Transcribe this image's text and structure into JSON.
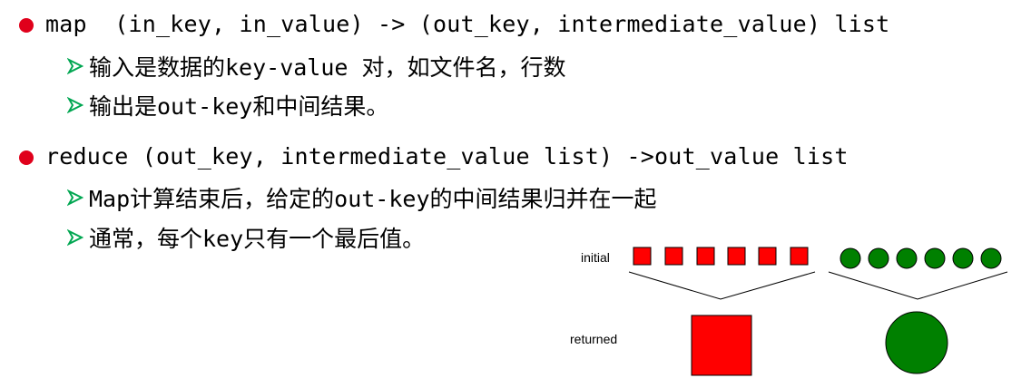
{
  "bullets": [
    {
      "text": "map  (in_key, in_value) -> (out_key, intermediate_value) list",
      "subitems": [
        "输入是数据的key-value 对，如文件名，行数",
        "输出是out-key和中间结果。"
      ]
    },
    {
      "text": "reduce (out_key, intermediate_value list) ->out_value list",
      "subitems": [
        "Map计算结束后，给定的out-key的中间结果归并在一起",
        "通常，每个key只有一个最后值。"
      ]
    }
  ],
  "diagram": {
    "label_initial": "initial",
    "label_returned": "returned",
    "colors": {
      "red": "#ff0000",
      "green": "#008000",
      "bullet": "#e0001b",
      "arrow": "#00a651"
    }
  }
}
